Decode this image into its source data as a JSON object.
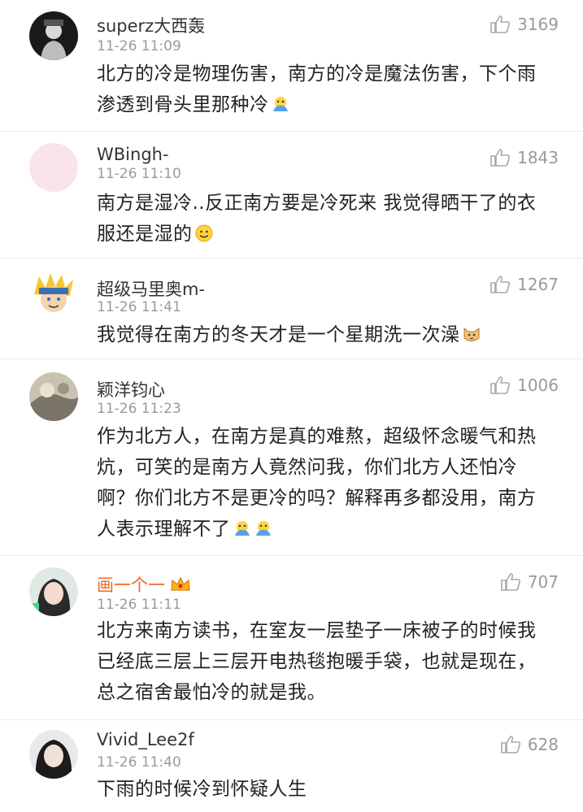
{
  "comments": [
    {
      "user": "superz大西轰",
      "time": "11-26 11:09",
      "likes": "3169",
      "text": "北方的冷是物理伤害，南方的冷是魔法伤害，下个雨渗透到骨头里那种冷",
      "emoji": "cold-emoji-icon"
    },
    {
      "user": "WBingh-",
      "time": "11-26 11:10",
      "likes": "1843",
      "text": "南方是湿冷..反正南方要是冷死来 我觉得晒干了的衣服还是湿的",
      "emoji": "smile-emoji-icon"
    },
    {
      "user": "超级马里奥m-",
      "time": "11-26 11:41",
      "likes": "1267",
      "text": "我觉得在南方的冬天才是一个星期洗一次澡",
      "emoji": "cat-emoji-icon"
    },
    {
      "user": "颖洋钧心",
      "time": "11-26 11:23",
      "likes": "1006",
      "text": "作为北方人，在南方是真的难熬，超级怀念暖气和热炕，可笑的是南方人竟然问我，你们北方人还怕冷啊？你们北方不是更冷的吗？解释再多都没用，南方人表示理解不了",
      "emoji": "cold-emoji-icon"
    },
    {
      "user": "画一个一",
      "time": "11-26 11:11",
      "likes": "707",
      "text": "北方来南方读书，在室友一层垫子一床被子的时候我已经底三层上三层开电热毯抱暖手袋，也就是现在，总之宿舍最怕冷的就是我。",
      "badge": "crown-icon"
    },
    {
      "user": "Vivid_Lee2f",
      "time": "11-26 11:40",
      "likes": "628",
      "text": "下雨的时候冷到怀疑人生"
    }
  ],
  "colors": {
    "vip_name": "#f06a1e",
    "meta": "#9a9a9a",
    "divider": "#ebebeb"
  }
}
